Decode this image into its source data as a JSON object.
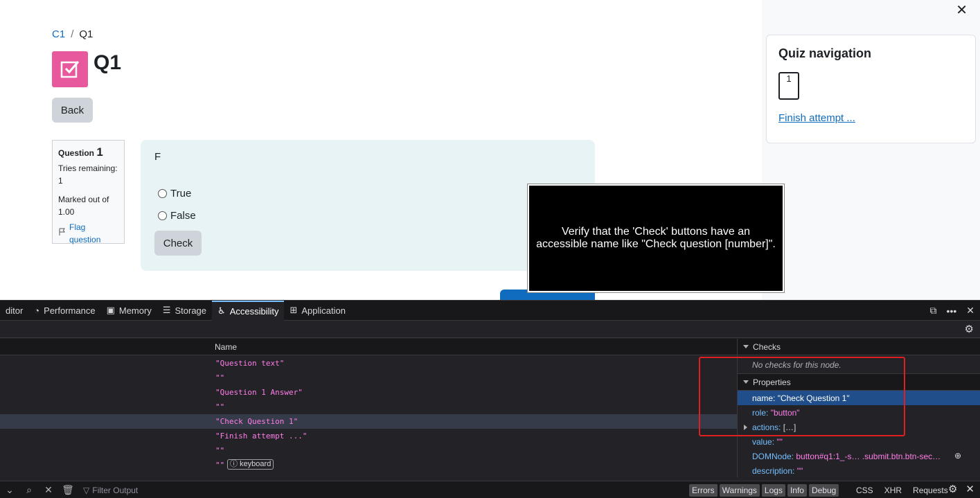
{
  "breadcrumb": {
    "course": "C1",
    "separator": "/",
    "current": "Q1"
  },
  "page_title": "Q1",
  "back_button": "Back",
  "question_info": {
    "question_label": "Question",
    "question_number": "1",
    "tries_remaining": "Tries remaining: 1",
    "marked_out_of": "Marked out of 1.00",
    "flag_question": "Flag question"
  },
  "question": {
    "text": "F",
    "answers": [
      "True",
      "False"
    ],
    "check_button": "Check"
  },
  "drawer": {
    "close": "✕",
    "quiz_navigation_title": "Quiz navigation",
    "nav_buttons": [
      "1"
    ],
    "finish_attempt": "Finish attempt ..."
  },
  "overlay_text": "Verify that the 'Check' buttons have an accessible name like \"Check question [number]\".",
  "devtools": {
    "tabs": [
      {
        "label": "ditor",
        "icon": ""
      },
      {
        "label": "Performance",
        "icon": "◔"
      },
      {
        "label": "Memory",
        "icon": "▣"
      },
      {
        "label": "Storage",
        "icon": "☰"
      },
      {
        "label": "Accessibility",
        "icon": "♿"
      },
      {
        "label": "Application",
        "icon": "⊞"
      }
    ],
    "active_tab": "Accessibility",
    "tree_header": "Name",
    "tree_rows": [
      "\"Question text\"",
      "\"\"",
      "\"Question 1 Answer\"",
      "\"\"",
      "\"Check Question 1\"",
      "\"Finish attempt ...\"",
      "\"\"",
      "\"\""
    ],
    "keyboard_badge": "keyboard",
    "checks_header": "Checks",
    "no_checks": "No checks for this node.",
    "properties_header": "Properties",
    "properties": [
      {
        "key": "name:",
        "value": "\"Check Question 1\""
      },
      {
        "key": "role:",
        "value": "\"button\""
      },
      {
        "key": "actions:",
        "value": "[…]"
      },
      {
        "key": "value:",
        "value": "\"\""
      },
      {
        "key": "DOMNode:",
        "value": "button#q1:1_-s…  .submit.btn.btn-sec…"
      },
      {
        "key": "description:",
        "value": "\"\""
      }
    ],
    "filter_placeholder": "Filter Output",
    "log_filters": [
      "Errors",
      "Warnings",
      "Logs",
      "Info",
      "Debug"
    ],
    "net_filters": [
      "CSS",
      "XHR",
      "Requests"
    ]
  },
  "colors": {
    "link": "#0f6cbf",
    "quiz_icon": "#e8589c",
    "question_bg": "#e7f3f5",
    "devtools_bg": "#232327",
    "highlight_box": "#e02020"
  }
}
